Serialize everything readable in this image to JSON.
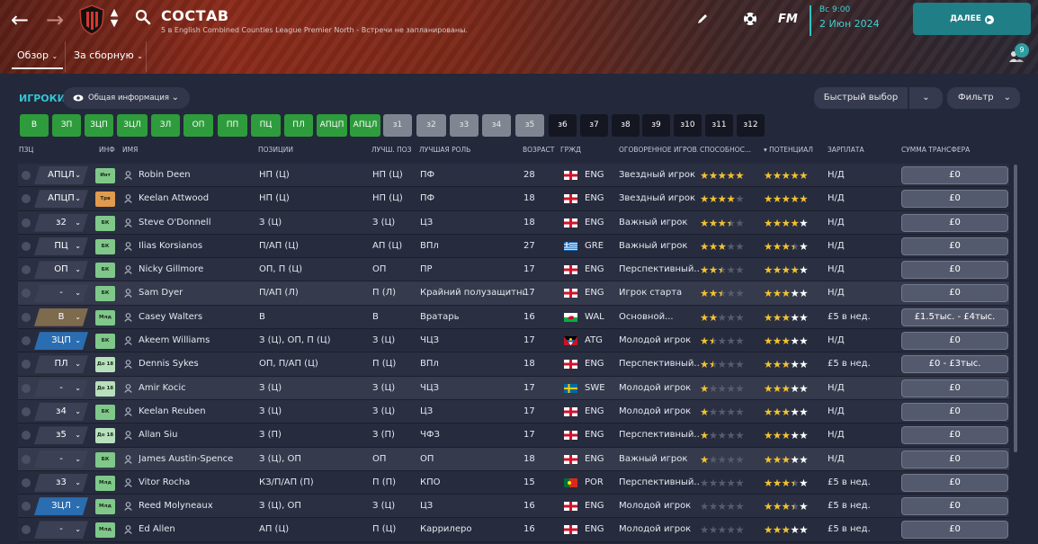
{
  "header": {
    "title": "СОСТАВ",
    "subtitle": "5 в English Combined Counties League Premier North - Встречи не запланированы.",
    "tabs": [
      "Обзор",
      "За сборную"
    ],
    "fm_logo": "FM",
    "date_day": "Вс 9:00",
    "date_full": "2 Июн 2024",
    "continue_label": "ДАЛЕЕ",
    "notification_count": "9",
    "accent_color": "#2ec4c4"
  },
  "toolbar": {
    "players_label": "ИГРОКИ",
    "view_dropdown": "Общая информация",
    "quick_pick": "Быстрый выбор",
    "filter": "Фильтр"
  },
  "position_buttons": [
    {
      "label": "В",
      "style": "g"
    },
    {
      "label": "ЗП",
      "style": "g"
    },
    {
      "label": "ЗЦП",
      "style": "g"
    },
    {
      "label": "ЗЦЛ",
      "style": "g"
    },
    {
      "label": "ЗЛ",
      "style": "g"
    },
    {
      "label": "ОП",
      "style": "g"
    },
    {
      "label": "ПП",
      "style": "g"
    },
    {
      "label": "ПЦ",
      "style": "g"
    },
    {
      "label": "ПЛ",
      "style": "g"
    },
    {
      "label": "АПЦП",
      "style": "g"
    },
    {
      "label": "АПЦЛ",
      "style": "g"
    },
    {
      "label": "з1",
      "style": "s"
    },
    {
      "label": "з2",
      "style": "s"
    },
    {
      "label": "з3",
      "style": "s"
    },
    {
      "label": "з4",
      "style": "s"
    },
    {
      "label": "з5",
      "style": "s"
    },
    {
      "label": "з6",
      "style": "k"
    },
    {
      "label": "з7",
      "style": "k"
    },
    {
      "label": "з8",
      "style": "k"
    },
    {
      "label": "з9",
      "style": "k"
    },
    {
      "label": "з10",
      "style": "k"
    },
    {
      "label": "з11",
      "style": "k"
    },
    {
      "label": "з12",
      "style": "k"
    }
  ],
  "columns": [
    "ПЗЦ",
    "ИНФ",
    "ИМЯ",
    "ПОЗИЦИИ",
    "ЛУЧШ. ПОЗ",
    "ЛУЧШАЯ РОЛЬ",
    "ВОЗРАСТ",
    "ГРЖД",
    "ОГОВОРЕННОЕ ИГРОВ...",
    "СПОСОБНОС...",
    "ПОТЕНЦИАЛ",
    "ЗАРПЛАТА",
    "СУММА ТРАНСФЕРА"
  ],
  "players": [
    {
      "slot": "АПЦЛ",
      "slot_style": "dash",
      "info": "Инт",
      "info_style": "gr",
      "name": "Robin Deen",
      "positions": "НП (Ц)",
      "best_pos": "НП (Ц)",
      "best_role": "ПФ",
      "age": "28",
      "nat": "ENG",
      "flag": "eng",
      "status": "Звездный игрок",
      "ability": 5,
      "potential": 5,
      "wage": "Н/Д",
      "fee": "£0"
    },
    {
      "slot": "АПЦП",
      "slot_style": "dash",
      "info": "Трв",
      "info_style": "or",
      "name": "Keelan Attwood",
      "positions": "НП (Ц)",
      "best_pos": "НП (Ц)",
      "best_role": "ПФ",
      "age": "18",
      "nat": "ENG",
      "flag": "eng",
      "status": "Звездный игрок",
      "ability": 4,
      "potential": 5,
      "wage": "Н/Д",
      "fee": "£0"
    },
    {
      "slot": "з2",
      "slot_style": "dash",
      "info": "БК",
      "info_style": "gr",
      "name": "Steve O'Donnell",
      "positions": "З (Ц)",
      "best_pos": "З (Ц)",
      "best_role": "ЦЗ",
      "age": "18",
      "nat": "ENG",
      "flag": "eng",
      "status": "Важный игрок",
      "ability": 3.5,
      "potential": 4,
      "wage": "Н/Д",
      "fee": "£0"
    },
    {
      "slot": "ПЦ",
      "slot_style": "dash",
      "info": "БК",
      "info_style": "gr",
      "name": "Ilias Korsianos",
      "positions": "П/АП (Ц)",
      "best_pos": "АП (Ц)",
      "best_role": "ВПл",
      "age": "27",
      "nat": "GRE",
      "flag": "gre",
      "status": "Важный игрок",
      "ability": 3,
      "potential": 3.5,
      "wage": "Н/Д",
      "fee": "£0"
    },
    {
      "slot": "ОП",
      "slot_style": "dash",
      "info": "БК",
      "info_style": "gr",
      "name": "Nicky Gillmore",
      "positions": "ОП, П (Ц)",
      "best_pos": "ОП",
      "best_role": "ПР",
      "age": "17",
      "nat": "ENG",
      "flag": "eng",
      "status": "Перспективный...",
      "ability": 2.5,
      "potential": 4,
      "wage": "Н/Д",
      "fee": "£0"
    },
    {
      "slot": "-",
      "slot_style": "dash",
      "info": "БК",
      "info_style": "gr",
      "name": "Sam Dyer",
      "positions": "П/АП (Л)",
      "best_pos": "П (Л)",
      "best_role": "Крайний полузащитник",
      "age": "17",
      "nat": "ENG",
      "flag": "eng",
      "status": "Игрок старта",
      "ability": 2.5,
      "potential": 3,
      "wage": "Н/Д",
      "fee": "£0"
    },
    {
      "slot": "В",
      "slot_style": "brown",
      "info": "Млд",
      "info_style": "gr",
      "name": "Casey Walters",
      "positions": "В",
      "best_pos": "В",
      "best_role": "Вратарь",
      "age": "16",
      "nat": "WAL",
      "flag": "wal",
      "status": "Основной...",
      "ability": 2,
      "potential": 3,
      "wage": "£5 в нед.",
      "fee": "£1.5тыс. - £4тыс."
    },
    {
      "slot": "ЗЦП",
      "slot_style": "blue",
      "info": "БК",
      "info_style": "gr",
      "name": "Akeem Williams",
      "positions": "З (Ц), ОП, П (Ц)",
      "best_pos": "З (Ц)",
      "best_role": "ЧЦЗ",
      "age": "17",
      "nat": "ATG",
      "flag": "atg",
      "status": "Молодой игрок",
      "ability": 1.5,
      "potential": 3,
      "wage": "Н/Д",
      "fee": "£0"
    },
    {
      "slot": "ПЛ",
      "slot_style": "dash",
      "info": "До 18",
      "info_style": "pl",
      "name": "Dennis Sykes",
      "positions": "ОП, П/АП (Ц)",
      "best_pos": "П (Ц)",
      "best_role": "ВПл",
      "age": "18",
      "nat": "ENG",
      "flag": "eng",
      "status": "Перспективный...",
      "ability": 1.5,
      "potential": 3,
      "wage": "£5 в нед.",
      "fee": "£0 - £3тыс."
    },
    {
      "slot": "-",
      "slot_style": "dash",
      "info": "До 18",
      "info_style": "pl",
      "name": "Amir Kocic",
      "positions": "З (Ц)",
      "best_pos": "З (Ц)",
      "best_role": "ЧЦЗ",
      "age": "17",
      "nat": "SWE",
      "flag": "swe",
      "status": "Молодой игрок",
      "ability": 1,
      "potential": 3,
      "wage": "Н/Д",
      "fee": "£0"
    },
    {
      "slot": "з4",
      "slot_style": "dash",
      "info": "БК",
      "info_style": "gr",
      "name": "Keelan Reuben",
      "positions": "З (Ц)",
      "best_pos": "З (Ц)",
      "best_role": "ЦЗ",
      "age": "17",
      "nat": "ENG",
      "flag": "eng",
      "status": "Молодой игрок",
      "ability": 1,
      "potential": 3,
      "wage": "Н/Д",
      "fee": "£0"
    },
    {
      "slot": "з5",
      "slot_style": "dash",
      "info": "До 18",
      "info_style": "pl",
      "name": "Allan Siu",
      "positions": "З (П)",
      "best_pos": "З (П)",
      "best_role": "ЧФЗ",
      "age": "17",
      "nat": "ENG",
      "flag": "eng",
      "status": "Перспективный...",
      "ability": 1,
      "potential": 3,
      "wage": "Н/Д",
      "fee": "£0"
    },
    {
      "slot": "-",
      "slot_style": "dash",
      "info": "БК",
      "info_style": "gr",
      "name": "James Austin-Spence",
      "positions": "З (Ц), ОП",
      "best_pos": "ОП",
      "best_role": "ОП",
      "age": "18",
      "nat": "ENG",
      "flag": "eng",
      "status": "Важный игрок",
      "ability": 1,
      "potential": 3,
      "wage": "Н/Д",
      "fee": "£0"
    },
    {
      "slot": "з3",
      "slot_style": "dash",
      "info": "Млд",
      "info_style": "gr",
      "name": "Vitor Rocha",
      "positions": "КЗ/П/АП (П)",
      "best_pos": "П (П)",
      "best_role": "КПО",
      "age": "15",
      "nat": "POR",
      "flag": "por",
      "status": "Перспективный...",
      "ability": 0,
      "potential": 3.5,
      "wage": "£5 в нед.",
      "fee": "£0"
    },
    {
      "slot": "ЗЦЛ",
      "slot_style": "blue",
      "info": "Млд",
      "info_style": "gr",
      "name": "Reed Molyneaux",
      "positions": "З (Ц), ОП",
      "best_pos": "З (Ц)",
      "best_role": "ЦЗ",
      "age": "16",
      "nat": "ENG",
      "flag": "eng",
      "status": "Молодой игрок",
      "ability": 0,
      "potential": 3.5,
      "wage": "£5 в нед.",
      "fee": "£0"
    },
    {
      "slot": "-",
      "slot_style": "dash",
      "info": "Млд",
      "info_style": "gr",
      "name": "Ed Allen",
      "positions": "АП (Ц)",
      "best_pos": "П (Ц)",
      "best_role": "Каррилеро",
      "age": "16",
      "nat": "ENG",
      "flag": "eng",
      "status": "Молодой игрок",
      "ability": 0,
      "potential": 3,
      "wage": "£5 в нед.",
      "fee": "£0"
    }
  ]
}
